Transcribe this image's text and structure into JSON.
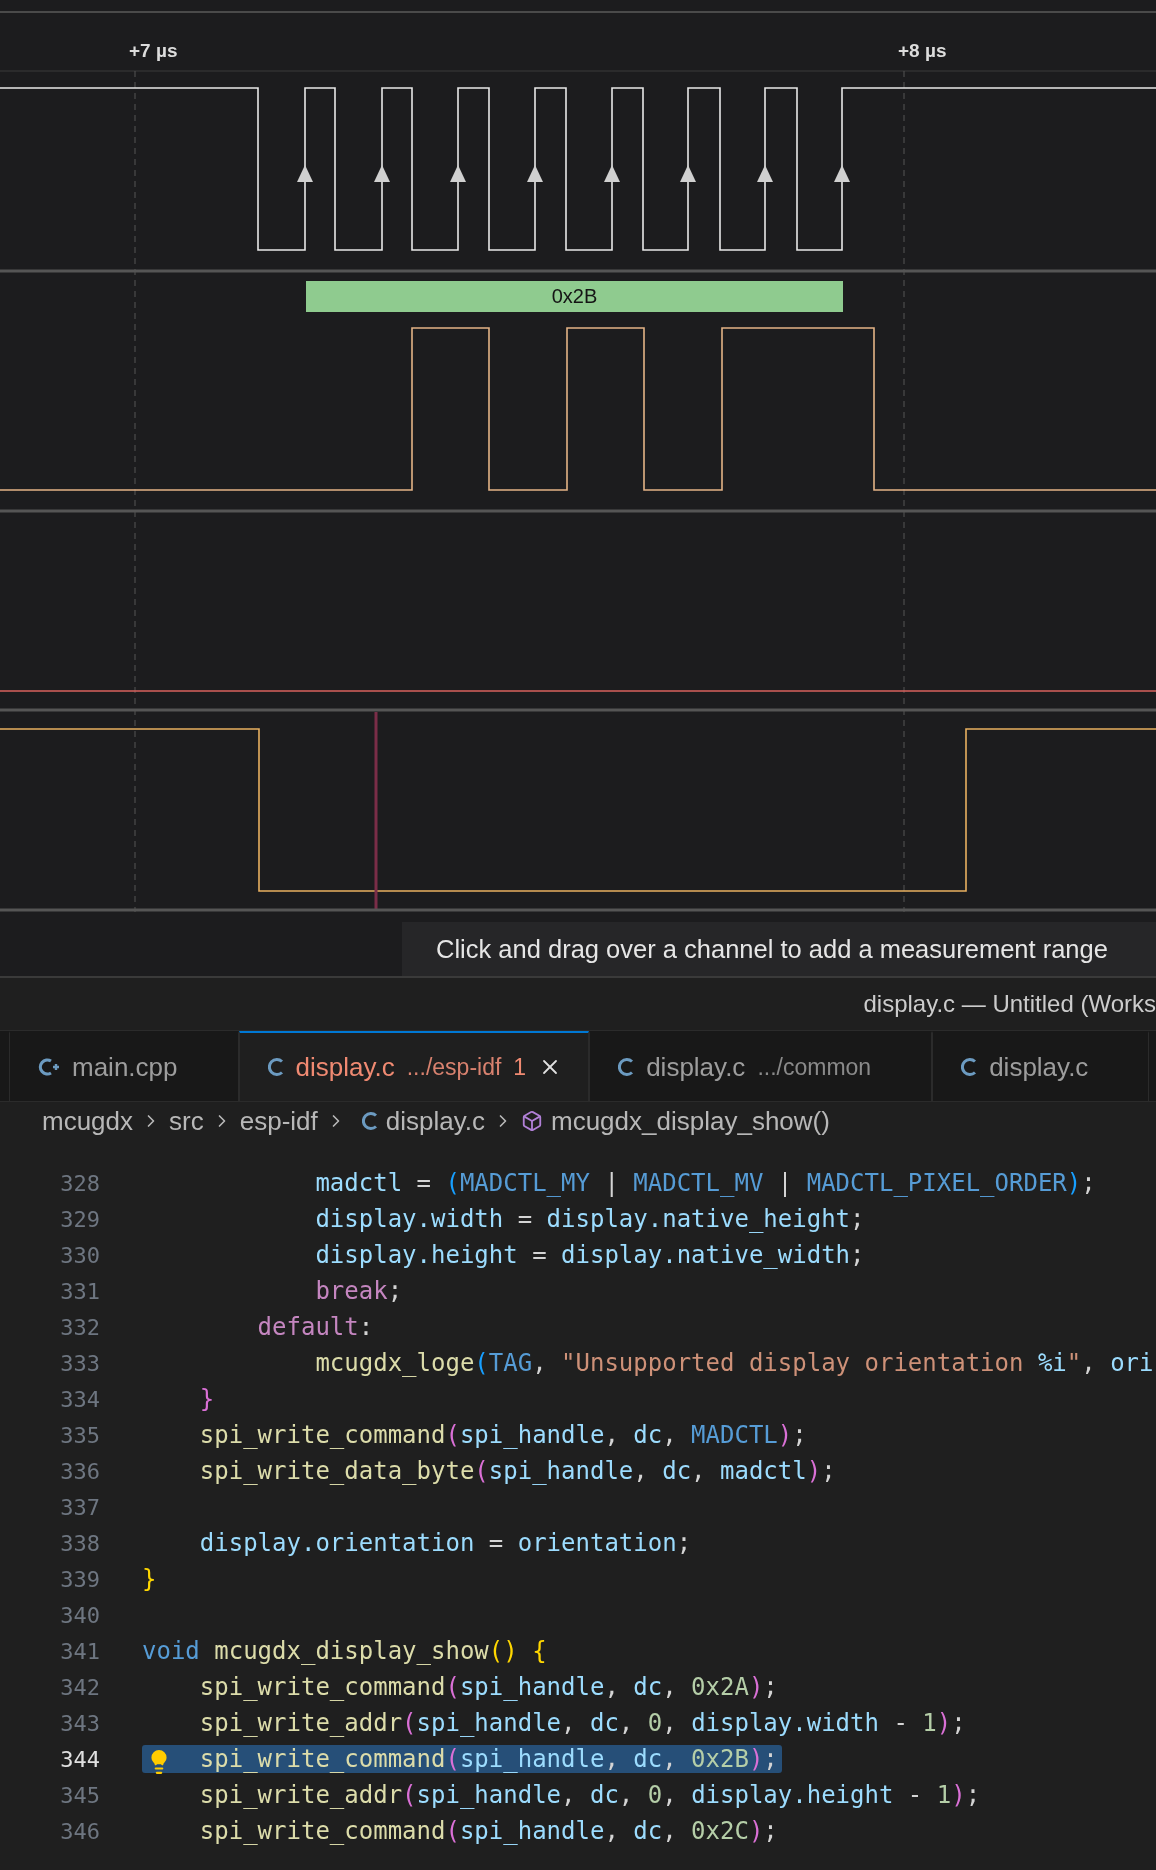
{
  "timeline": {
    "time_markers": [
      "+7 µs",
      "+8 µs"
    ],
    "decoded_byte": "0x2B"
  },
  "hint": "Click and drag over a channel to add a measurement range",
  "window_title": "display.c — Untitled (Works",
  "tabs": [
    {
      "kind": "cpp",
      "label": "main.cpp",
      "selected": false
    },
    {
      "kind": "c",
      "label": "display.c",
      "description": ".../esp-idf",
      "problem_count": "1",
      "selected": true
    },
    {
      "kind": "c",
      "label": "display.c",
      "description": ".../common",
      "selected": false
    },
    {
      "kind": "c",
      "label": "display.c",
      "selected": false
    }
  ],
  "breadcrumb": [
    {
      "kind": "folder",
      "label": "mcugdx"
    },
    {
      "kind": "folder",
      "label": "src"
    },
    {
      "kind": "folder",
      "label": "esp-idf"
    },
    {
      "kind": "file",
      "label": "display.c"
    },
    {
      "kind": "symbol",
      "label": "mcugdx_display_show()"
    }
  ],
  "code": [
    {
      "children": [
        {
          "children": [
            {
              "children": [
                {
                  "number": "328",
                  "current": false,
                  "tokens": [
                    {
                      "text": "madctl",
                      "kind": "variable"
                    },
                    {
                      "text": " = ",
                      "kind": "plain"
                    },
                    {
                      "text": "(",
                      "kind": "bracket-blue"
                    },
                    {
                      "text": "MADCTL_MY",
                      "kind": "macro"
                    },
                    {
                      "text": " | ",
                      "kind": "plain"
                    },
                    {
                      "text": "MADCTL_MV",
                      "kind": "macro"
                    },
                    {
                      "text": " | ",
                      "kind": "plain"
                    },
                    {
                      "text": "MADCTL_PIXEL_ORDER",
                      "kind": "macro"
                    },
                    {
                      "text": ")",
                      "kind": "bracket-blue"
                    },
                    {
                      "text": ";",
                      "kind": "plain"
                    }
                  ]
                },
                {
                  "number": "329",
                  "current": false,
                  "tokens": [
                    {
                      "text": "display.width",
                      "kind": "variable"
                    },
                    {
                      "text": " = ",
                      "kind": "plain"
                    },
                    {
                      "text": "display.native_height",
                      "kind": "variable"
                    },
                    {
                      "text": ";",
                      "kind": "plain"
                    }
                  ]
                },
                {
                  "number": "330",
                  "current": false,
                  "tokens": [
                    {
                      "text": "display.height",
                      "kind": "variable"
                    },
                    {
                      "text": " = ",
                      "kind": "plain"
                    },
                    {
                      "text": "display.native_width",
                      "kind": "variable"
                    },
                    {
                      "text": ";",
                      "kind": "plain"
                    }
                  ]
                },
                {
                  "number": "331",
                  "current": false,
                  "tokens": [
                    {
                      "text": "break",
                      "kind": "keyword"
                    },
                    {
                      "text": ";",
                      "kind": "plain"
                    }
                  ]
                }
              ]
            },
            {
              "number": "332",
              "current": false,
              "tokens": [
                {
                  "text": "default",
                  "kind": "keyword"
                },
                {
                  "text": ":",
                  "kind": "plain"
                }
              ]
            },
            {
              "children": [
                {
                  "number": "333",
                  "current": false,
                  "tokens": [
                    {
                      "text": "mcugdx_loge",
                      "kind": "function"
                    },
                    {
                      "text": "(",
                      "kind": "bracket-blue"
                    },
                    {
                      "text": "TAG",
                      "kind": "macro"
                    },
                    {
                      "text": ", ",
                      "kind": "plain"
                    },
                    {
                      "text": "\"Unsupported display orientation ",
                      "kind": "string"
                    },
                    {
                      "text": "%i",
                      "kind": "variable"
                    },
                    {
                      "text": "\"",
                      "kind": "string"
                    },
                    {
                      "text": ", ",
                      "kind": "plain"
                    },
                    {
                      "text": "ori",
                      "kind": "variable"
                    }
                  ]
                }
              ]
            }
          ]
        },
        {
          "number": "334",
          "current": false,
          "tokens": [
            {
              "text": "}",
              "kind": "bracket-pink"
            }
          ]
        },
        {
          "number": "335",
          "current": false,
          "tokens": [
            {
              "text": "spi_write_command",
              "kind": "function"
            },
            {
              "text": "(",
              "kind": "bracket-pink"
            },
            {
              "text": "spi_handle",
              "kind": "variable"
            },
            {
              "text": ", ",
              "kind": "plain"
            },
            {
              "text": "dc",
              "kind": "variable"
            },
            {
              "text": ", ",
              "kind": "plain"
            },
            {
              "text": "MADCTL",
              "kind": "macro"
            },
            {
              "text": ")",
              "kind": "bracket-pink"
            },
            {
              "text": ";",
              "kind": "plain"
            }
          ]
        },
        {
          "number": "336",
          "current": false,
          "tokens": [
            {
              "text": "spi_write_data_byte",
              "kind": "function"
            },
            {
              "text": "(",
              "kind": "bracket-pink"
            },
            {
              "text": "spi_handle",
              "kind": "variable"
            },
            {
              "text": ", ",
              "kind": "plain"
            },
            {
              "text": "dc",
              "kind": "variable"
            },
            {
              "text": ", ",
              "kind": "plain"
            },
            {
              "text": "madctl",
              "kind": "variable"
            },
            {
              "text": ")",
              "kind": "bracket-pink"
            },
            {
              "text": ";",
              "kind": "plain"
            }
          ]
        },
        {
          "number": "337",
          "current": false
        },
        {
          "number": "338",
          "current": false,
          "tokens": [
            {
              "text": "display.orientation",
              "kind": "variable"
            },
            {
              "text": " = ",
              "kind": "plain"
            },
            {
              "text": "orientation",
              "kind": "variable"
            },
            {
              "text": ";",
              "kind": "plain"
            }
          ]
        }
      ]
    },
    {
      "number": "339",
      "current": false,
      "tokens": [
        {
          "text": "}",
          "kind": "bracket-yellow"
        }
      ]
    },
    {
      "number": "340",
      "current": false
    },
    {
      "number": "341",
      "current": false,
      "tokens": [
        {
          "text": "void ",
          "kind": "storage"
        },
        {
          "text": "mcugdx_display_show",
          "kind": "function"
        },
        {
          "text": "() {",
          "kind": "bracket-yellow"
        }
      ]
    },
    {
      "children": [
        {
          "number": "342",
          "current": false,
          "tokens": [
            {
              "text": "spi_write_command",
              "kind": "function"
            },
            {
              "text": "(",
              "kind": "bracket-pink"
            },
            {
              "text": "spi_handle",
              "kind": "variable"
            },
            {
              "text": ", ",
              "kind": "plain"
            },
            {
              "text": "dc",
              "kind": "variable"
            },
            {
              "text": ", ",
              "kind": "plain"
            },
            {
              "text": "0x2A",
              "kind": "number"
            },
            {
              "text": ")",
              "kind": "bracket-pink"
            },
            {
              "text": ";",
              "kind": "plain"
            }
          ]
        },
        {
          "number": "343",
          "current": false,
          "tokens": [
            {
              "text": "spi_write_addr",
              "kind": "function"
            },
            {
              "text": "(",
              "kind": "bracket-pink"
            },
            {
              "text": "spi_handle",
              "kind": "variable"
            },
            {
              "text": ", ",
              "kind": "plain"
            },
            {
              "text": "dc",
              "kind": "variable"
            },
            {
              "text": ", ",
              "kind": "plain"
            },
            {
              "text": "0",
              "kind": "number"
            },
            {
              "text": ", ",
              "kind": "plain"
            },
            {
              "text": "display.width",
              "kind": "variable"
            },
            {
              "text": " - ",
              "kind": "plain"
            },
            {
              "text": "1",
              "kind": "number"
            },
            {
              "text": ")",
              "kind": "bracket-pink"
            },
            {
              "text": ";",
              "kind": "plain"
            }
          ]
        },
        {
          "number": "344",
          "current": true,
          "tokens": [
            {
              "text": "spi_write_command",
              "kind": "function"
            },
            {
              "text": "(",
              "kind": "bracket-pink"
            },
            {
              "text": "spi_handle",
              "kind": "variable"
            },
            {
              "text": ", ",
              "kind": "plain"
            },
            {
              "text": "dc",
              "kind": "variable"
            },
            {
              "text": ", ",
              "kind": "plain"
            },
            {
              "text": "0x2B",
              "kind": "number"
            },
            {
              "text": ")",
              "kind": "bracket-pink"
            },
            {
              "text": ";",
              "kind": "plain"
            }
          ]
        },
        {
          "number": "345",
          "current": false,
          "tokens": [
            {
              "text": "spi_write_addr",
              "kind": "function"
            },
            {
              "text": "(",
              "kind": "bracket-pink"
            },
            {
              "text": "spi_handle",
              "kind": "variable"
            },
            {
              "text": ", ",
              "kind": "plain"
            },
            {
              "text": "dc",
              "kind": "variable"
            },
            {
              "text": ", ",
              "kind": "plain"
            },
            {
              "text": "0",
              "kind": "number"
            },
            {
              "text": ", ",
              "kind": "plain"
            },
            {
              "text": "display.height",
              "kind": "variable"
            },
            {
              "text": " - ",
              "kind": "plain"
            },
            {
              "text": "1",
              "kind": "number"
            },
            {
              "text": ")",
              "kind": "bracket-pink"
            },
            {
              "text": ";",
              "kind": "plain"
            }
          ]
        },
        {
          "number": "346",
          "current": false,
          "tokens": [
            {
              "text": "spi_write_command",
              "kind": "function"
            },
            {
              "text": "(",
              "kind": "bracket-pink"
            },
            {
              "text": "spi_handle",
              "kind": "variable"
            },
            {
              "text": ", ",
              "kind": "plain"
            },
            {
              "text": "dc",
              "kind": "variable"
            },
            {
              "text": ", ",
              "kind": "plain"
            },
            {
              "text": "0x2C",
              "kind": "number"
            },
            {
              "text": ")",
              "kind": "bracket-pink"
            },
            {
              "text": ";",
              "kind": "plain"
            }
          ]
        }
      ]
    }
  ]
}
